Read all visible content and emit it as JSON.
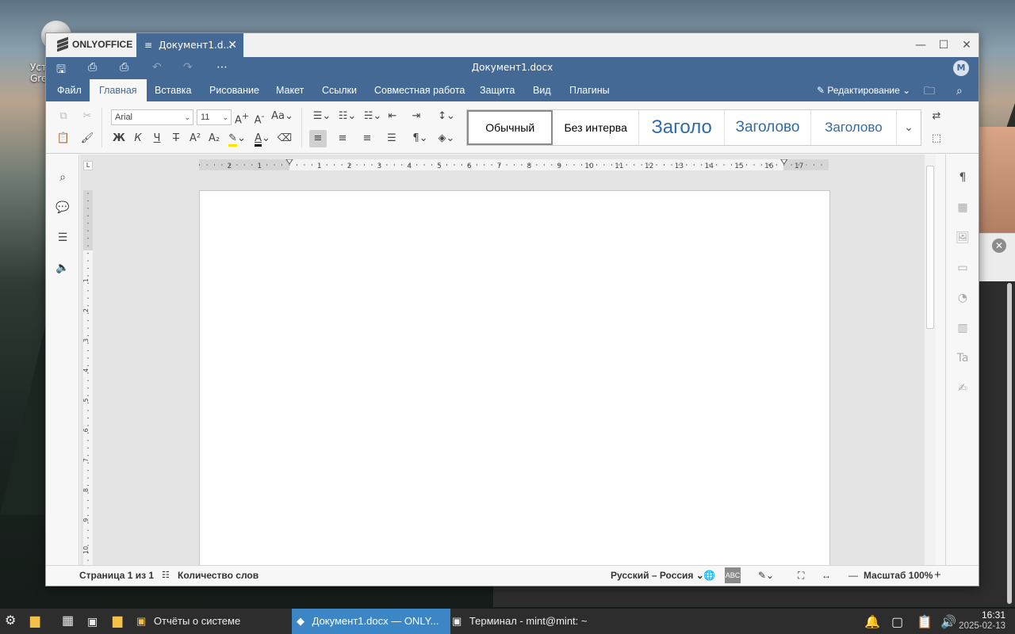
{
  "desktop": {
    "icon_label_line1": "Уст",
    "icon_label_line2": "Gre"
  },
  "app": {
    "brand": "ONLYOFFICE",
    "tab_title": "Документ1.d...",
    "doc_title": "Документ1.docx",
    "avatar": "M",
    "menu": [
      "Файл",
      "Главная",
      "Вставка",
      "Рисование",
      "Макет",
      "Ссылки",
      "Совместная работа",
      "Защита",
      "Вид",
      "Плагины"
    ],
    "active_menu": "Главная",
    "mode": "Редактирование",
    "font_name": "Arial",
    "font_size": "11",
    "styles": [
      "Обычный",
      "Без интерва",
      "Заголо",
      "Заголово",
      "Заголово"
    ],
    "ruler_h": [
      "2",
      "1",
      "1",
      "2",
      "3",
      "4",
      "5",
      "6",
      "7",
      "8",
      "9",
      "10",
      "11",
      "12",
      "13",
      "14",
      "15",
      "16",
      "17"
    ],
    "ruler_v": [
      "1",
      "2",
      "3",
      "4",
      "5",
      "6",
      "7",
      "8",
      "9",
      "10"
    ],
    "toolbar_labels": {
      "bold": "Ж",
      "italic": "К",
      "underline": "Ч",
      "strike": "Т"
    },
    "status": {
      "page": "Страница 1 из 1",
      "words": "Количество слов",
      "language": "Русский – Россия",
      "zoom": "Масштаб 100%"
    }
  },
  "taskbar": {
    "tasks": [
      "Отчёты о системе",
      "Документ1.docx — ONLY...",
      "Терминал - mint@mint: ~"
    ],
    "time": "16:31",
    "date": "2025-02-13"
  }
}
